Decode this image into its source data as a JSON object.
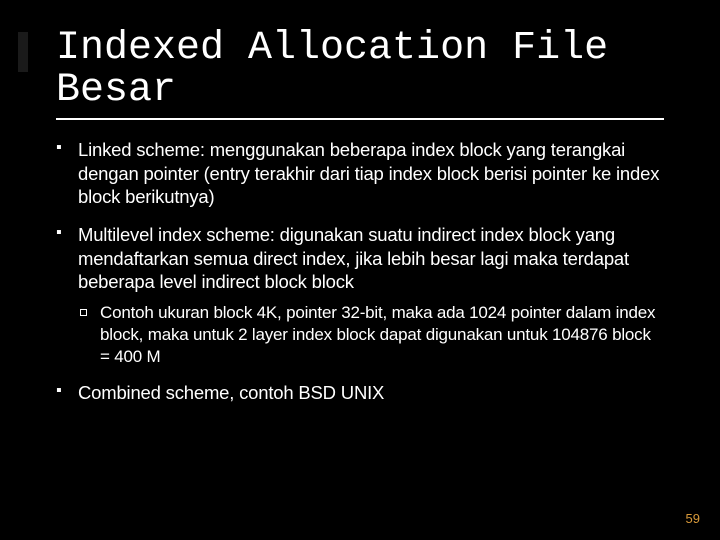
{
  "title_line1": "Indexed Allocation File",
  "title_line2": "Besar",
  "bullets": [
    {
      "text": "Linked scheme: menggunakan beberapa index block yang terangkai dengan pointer (entry terakhir dari tiap index block berisi pointer ke index block berikutnya)"
    },
    {
      "text": "Multilevel index scheme: digunakan suatu indirect index block yang mendaftarkan semua direct index, jika lebih besar lagi maka terdapat beberapa level indirect block block",
      "sub": [
        "Contoh ukuran block 4K, pointer 32-bit, maka ada 1024 pointer dalam index block, maka untuk 2 layer index block dapat digunakan untuk 104876 block = 400 M"
      ]
    },
    {
      "text": "Combined scheme, contoh BSD UNIX"
    }
  ],
  "page_number": "59"
}
